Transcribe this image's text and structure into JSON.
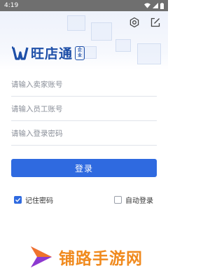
{
  "status_bar": {
    "time": "4:19"
  },
  "header": {
    "brand_name": "旺店通",
    "brand_badge": "企业",
    "settings_icon": "gear-icon",
    "edit_icon": "edit-icon"
  },
  "form": {
    "seller_account_placeholder": "请输入卖家账号",
    "employee_account_placeholder": "请输入员工账号",
    "password_placeholder": "请输入登录密码",
    "login_label": "登录"
  },
  "options": {
    "remember_password_label": "记住密码",
    "remember_password_checked": true,
    "auto_login_label": "自动登录",
    "auto_login_checked": false
  },
  "watermark": {
    "text": "铺路手游网"
  },
  "colors": {
    "accent": "#2f6ae0",
    "brand": "#1e4fa8",
    "watermark": "#f08a1e"
  }
}
